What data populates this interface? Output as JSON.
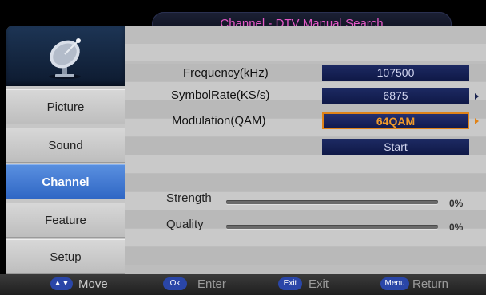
{
  "title": "Channel - DTV Manual Search",
  "sidebar": {
    "items": [
      {
        "label": "Picture",
        "active": false
      },
      {
        "label": "Sound",
        "active": false
      },
      {
        "label": "Channel",
        "active": true
      },
      {
        "label": "Feature",
        "active": false
      },
      {
        "label": "Setup",
        "active": false
      }
    ]
  },
  "fields": {
    "frequency": {
      "label": "Frequency(kHz)",
      "value": "107500"
    },
    "symbol_rate": {
      "label": "SymbolRate(KS/s)",
      "value": "6875"
    },
    "modulation": {
      "label": "Modulation(QAM)",
      "value": "64QAM"
    },
    "start": {
      "label": "Start"
    }
  },
  "signal": {
    "strength": {
      "label": "Strength",
      "value_text": "0%",
      "level": 0
    },
    "quality": {
      "label": "Quality",
      "value_text": "0%",
      "level": 0
    }
  },
  "help": {
    "move": {
      "key": "▲▼",
      "label": "Move"
    },
    "enter": {
      "key": "Ok",
      "label": "Enter"
    },
    "exit": {
      "key": "Exit",
      "label": "Exit"
    },
    "return": {
      "key": "Menu",
      "label": "Return"
    }
  },
  "colors": {
    "accent_active": "#3a73d0",
    "title_text": "#e65ac8",
    "value_box": "#16205a",
    "selected_border": "#e08318"
  }
}
